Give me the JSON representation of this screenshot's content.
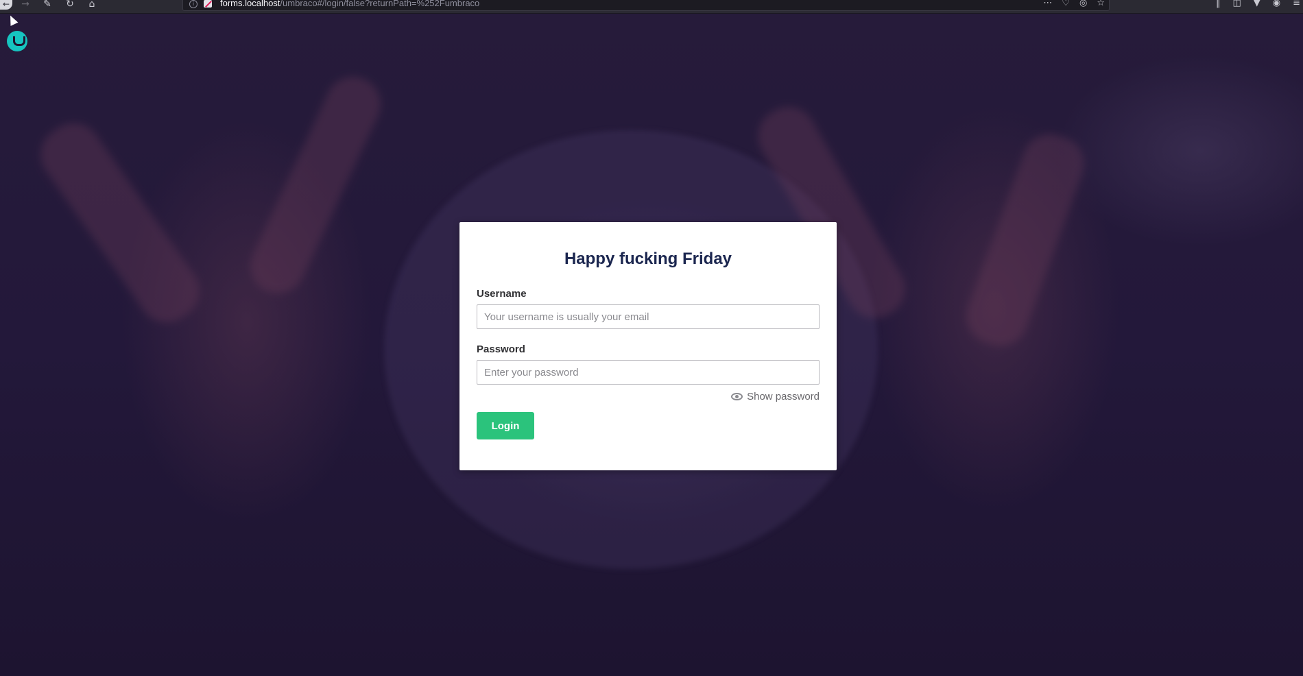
{
  "browser": {
    "url_host": "forms.localhost",
    "url_path": "/umbraco#/login/false?returnPath=%252Fumbraco",
    "info_icon": "i"
  },
  "login": {
    "title": "Happy fucking Friday",
    "username_label": "Username",
    "username_placeholder": "Your username is usually your email",
    "username_value": "",
    "password_label": "Password",
    "password_placeholder": "Enter your password",
    "password_value": "",
    "show_password_label": "Show password",
    "login_button_label": "Login"
  },
  "colors": {
    "accent": "#2bc37c",
    "logo": "#16c5c0",
    "background": "#231838",
    "title": "#1b264f"
  }
}
